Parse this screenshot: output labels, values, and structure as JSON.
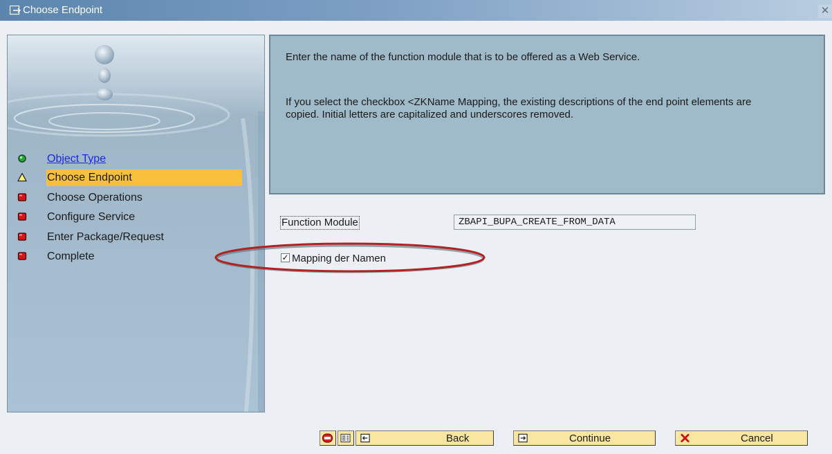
{
  "window": {
    "title": "Choose Endpoint",
    "close_symbol": "✕"
  },
  "wizard_steps": [
    {
      "label": "Object Type",
      "status": "done",
      "icon": "green-circle-icon"
    },
    {
      "label": "Choose Endpoint",
      "status": "current",
      "icon": "yellow-triangle-icon"
    },
    {
      "label": "Choose Operations",
      "status": "pending",
      "icon": "red-square-icon"
    },
    {
      "label": "Configure Service",
      "status": "pending",
      "icon": "red-square-icon"
    },
    {
      "label": "Enter Package/Request",
      "status": "pending",
      "icon": "red-square-icon"
    },
    {
      "label": "Complete",
      "status": "pending",
      "icon": "red-square-icon"
    }
  ],
  "help": {
    "paragraph1": "Enter the name of the function module that is to be offered as a Web Service.",
    "paragraph2": "If you select the checkbox <ZKName Mapping, the existing descriptions of the end point elements are copied. Initial letters are capitalized and underscores removed."
  },
  "form": {
    "function_module_label": "Function Module",
    "function_module_value": "ZBAPI_BUPA_CREATE_FROM_DATA",
    "mapping_checkbox_label": "Mapping der Namen",
    "mapping_checked": true
  },
  "footer": {
    "back_label": "Back",
    "continue_label": "Continue",
    "cancel_label": "Cancel"
  },
  "colors": {
    "titlebar": "#5b85ad",
    "panel": "#b3cadc",
    "active_step": "#f8c03d",
    "button": "#f9e6a0",
    "annotation_ellipse": "#b22222"
  }
}
